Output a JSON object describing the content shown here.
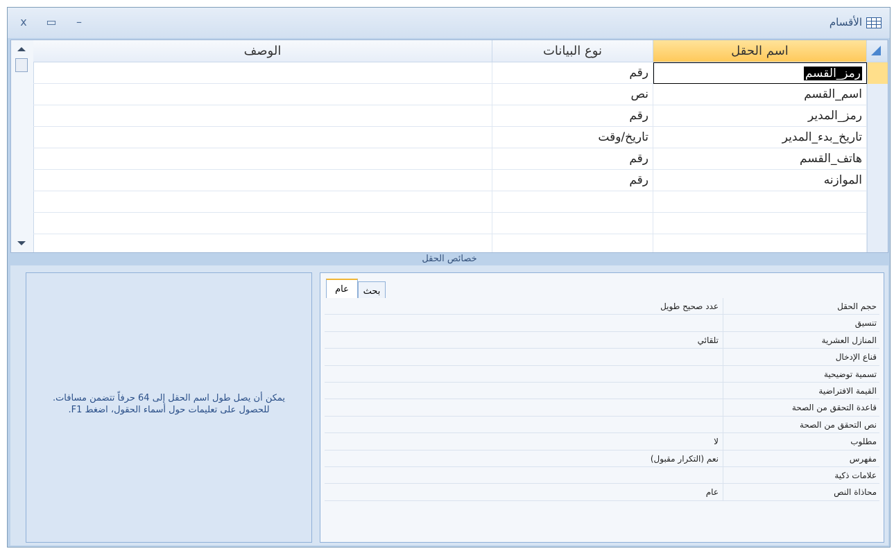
{
  "window": {
    "title": "الأقسام",
    "controls": {
      "close": "x",
      "maximize": "▭",
      "minimize": "–"
    }
  },
  "grid": {
    "headers": {
      "field_name": "اسم الحقل",
      "data_type": "نوع البيانات",
      "description": "الوصف"
    },
    "rows": [
      {
        "field_name": "رمز_القسم",
        "data_type": "رقم",
        "description": ""
      },
      {
        "field_name": "اسم_القسم",
        "data_type": "نص",
        "description": ""
      },
      {
        "field_name": "رمز_المدير",
        "data_type": "رقم",
        "description": ""
      },
      {
        "field_name": "تاريخ_بدء_المدير",
        "data_type": "تاريخ/وقت",
        "description": ""
      },
      {
        "field_name": "هاتف_القسم",
        "data_type": "رقم",
        "description": ""
      },
      {
        "field_name": "الموازنه",
        "data_type": "رقم",
        "description": ""
      }
    ]
  },
  "field_properties": {
    "section_label": "خصائص الحقل",
    "tabs": {
      "general": "عام",
      "lookup": "بحث"
    },
    "rows": [
      {
        "name": "حجم الحقل",
        "value": "عدد صحيح طويل"
      },
      {
        "name": "تنسيق",
        "value": ""
      },
      {
        "name": "المنازل العشرية",
        "value": "تلقائي"
      },
      {
        "name": "قناع الإدخال",
        "value": ""
      },
      {
        "name": "تسمية توضيحية",
        "value": ""
      },
      {
        "name": "القيمة الافتراضية",
        "value": ""
      },
      {
        "name": "قاعدة التحقق من الصحة",
        "value": ""
      },
      {
        "name": "نص التحقق من الصحة",
        "value": ""
      },
      {
        "name": "مطلوب",
        "value": "لا"
      },
      {
        "name": "مفهرس",
        "value": "نعم (التكرار مقبول)"
      },
      {
        "name": "علامات ذكية",
        "value": ""
      },
      {
        "name": "محاذاة النص",
        "value": "عام"
      }
    ]
  },
  "help": {
    "text": "يمكن أن يصل طول اسم الحقل إلى 64 حرفاً تتضمن مسافات. للحصول على تعليمات حول أسماء الحقول، اضغط F1."
  }
}
